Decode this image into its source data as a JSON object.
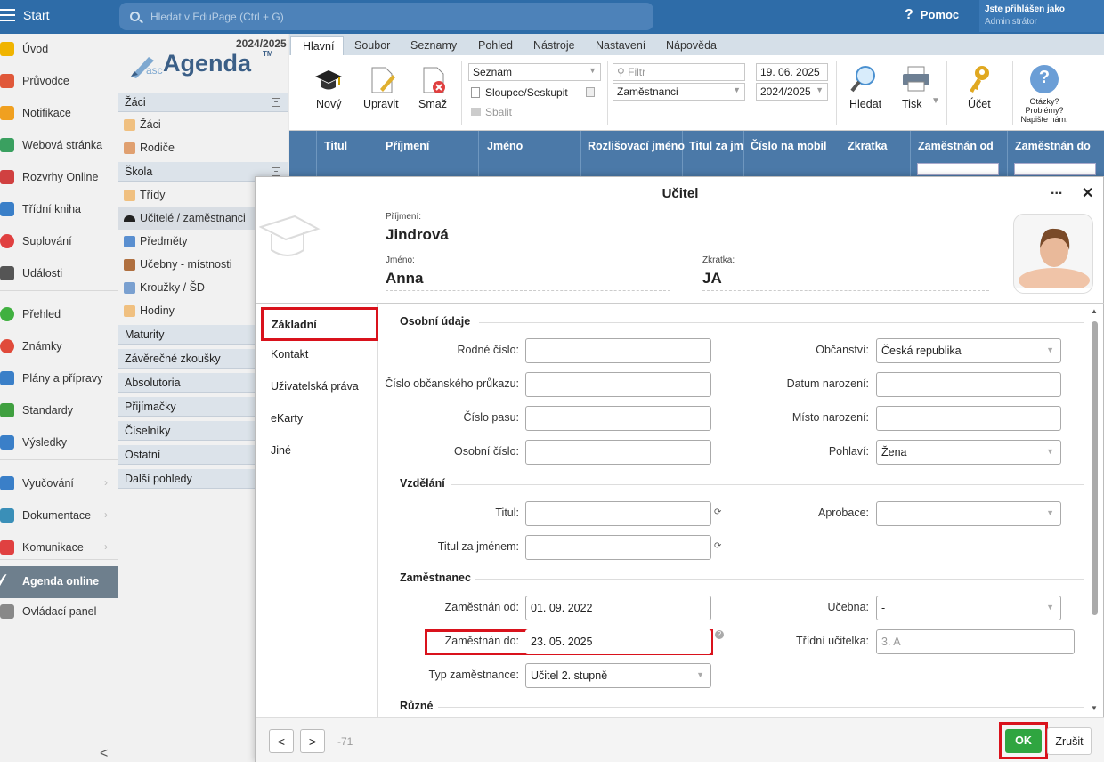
{
  "topbar": {
    "start": "Start",
    "search_placeholder": "Hledat v EduPage (Ctrl + G)",
    "help": "Pomoc",
    "user_line1": "Jste přihlášen jako",
    "user_line2": "Administrátor"
  },
  "nav": [
    {
      "label": "Úvod",
      "icon": "star-icon",
      "color": "#f0b400"
    },
    {
      "label": "Průvodce",
      "icon": "wand-icon",
      "color": "#e0583a"
    },
    {
      "label": "Notifikace",
      "icon": "mail-icon",
      "color": "#f0a020"
    },
    {
      "label": "Webová stránka",
      "icon": "home-icon",
      "color": "#3aa060"
    },
    {
      "label": "Rozvrhy Online",
      "icon": "calendar-icon",
      "color": "#d04040"
    },
    {
      "label": "Třídní kniha",
      "icon": "book-icon",
      "color": "#3a7fc8"
    },
    {
      "label": "Suplování",
      "icon": "person-icon",
      "color": "#e04040"
    },
    {
      "label": "Události",
      "icon": "calendar-icon",
      "color": "#555"
    },
    {
      "label": "Přehled",
      "icon": "check-icon",
      "color": "#40b040"
    },
    {
      "label": "Známky",
      "icon": "grades-icon",
      "color": "#e04a3a"
    },
    {
      "label": "Plány a přípravy",
      "icon": "briefcase-icon",
      "color": "#3a7fc8"
    },
    {
      "label": "Standardy",
      "icon": "shield-icon",
      "color": "#40a040"
    },
    {
      "label": "Výsledky",
      "icon": "bar-chart-icon",
      "color": "#3a7fc8"
    },
    {
      "label": "Vyučování",
      "icon": "open-book-icon",
      "color": "#3a7fc8"
    },
    {
      "label": "Dokumentace",
      "icon": "document-icon",
      "color": "#3a8fb8"
    },
    {
      "label": "Komunikace",
      "icon": "chat-icon",
      "color": "#e04040"
    },
    {
      "label": "Agenda online",
      "icon": "agenda-icon",
      "color": "#ffffff"
    },
    {
      "label": "Ovládací panel",
      "icon": "gear-icon",
      "color": "#888"
    }
  ],
  "agenda": {
    "year": "2024/2025",
    "logo_asc": "asc",
    "logo_agenda": "Agenda",
    "logo_tm": "TM",
    "sec_zaci": "Žáci",
    "item_zaci": "Žáci",
    "item_rodice": "Rodiče",
    "sec_skola": "Škola",
    "item_tridy": "Třídy",
    "item_ucitele": "Učitelé / zaměstnanci",
    "item_predmety": "Předměty",
    "item_ucebny": "Učebny - místnosti",
    "item_krouzky": "Kroužky / ŠD",
    "item_hodiny": "Hodiny",
    "maturity": "Maturity",
    "zaverecne": "Závěrečné zkoušky",
    "absolutoria": "Absolutoria",
    "prijimacky": "Přijímačky",
    "ciselniky": "Číselníky",
    "ostatni": "Ostatní",
    "dalsi": "Další pohledy"
  },
  "ribbon": {
    "tabs": [
      "Hlavní",
      "Soubor",
      "Seznamy",
      "Pohled",
      "Nástroje",
      "Nastavení",
      "Nápověda"
    ],
    "btn_novy": "Nový",
    "btn_upravit": "Upravit",
    "btn_smaz": "Smaž",
    "view_select": "Seznam",
    "sloupce": "Sloupce/Seskupit",
    "sbalit": "Sbalit",
    "filter_placeholder": "Filtr",
    "filter_select": "Zaměstnanci",
    "date": "19. 06. 2025",
    "year_select": "2024/2025",
    "btn_hledat": "Hledat",
    "btn_tisk": "Tisk",
    "btn_ucet": "Účet",
    "help1": "Otázky?",
    "help2": "Problémy?",
    "help3": "Napište nám."
  },
  "grid_headers": [
    "Titul",
    "Příjmení",
    "Jméno",
    "Rozlišovací jméno",
    "Titul za jm",
    "Číslo na mobil",
    "Zkratka",
    "Zaměstnán od",
    "Zaměstnán do"
  ],
  "dialog": {
    "title": "Učitel",
    "more": "...",
    "close": "✕",
    "lbl_prijmeni": "Příjmení:",
    "val_prijmeni": "Jindrová",
    "lbl_jmeno": "Jméno:",
    "val_jmeno": "Anna",
    "lbl_zkratka": "Zkratka:",
    "val_zkratka": "JA",
    "side_tabs": [
      "Základní",
      "Kontakt",
      "Uživatelská práva",
      "eKarty",
      "Jiné"
    ],
    "sec_osobni": "Osobní údaje",
    "sec_vzdelani": "Vzdělání",
    "sec_zamestnanec": "Zaměstnanec",
    "sec_ruzne": "Různé",
    "f_rodne_cislo": "Rodné číslo:",
    "f_op": "Číslo občanského průkazu:",
    "f_pas": "Číslo pasu:",
    "f_osobni": "Osobní číslo:",
    "f_obcanstvi": "Občanství:",
    "v_obcanstvi": "Česká republika",
    "f_datum": "Datum narození:",
    "f_misto": "Místo narození:",
    "f_pohlavi": "Pohlaví:",
    "v_pohlavi": "Žena",
    "f_titul": "Titul:",
    "f_titul_za": "Titul za jménem:",
    "f_aprobace": "Aprobace:",
    "f_od": "Zaměstnán od:",
    "v_od": "01. 09. 2022",
    "f_do": "Zaměstnán do:",
    "v_do": "23. 05. 2025",
    "f_typ": "Typ zaměstnance:",
    "v_typ": "Učitel 2. stupně",
    "f_ucebna": "Učebna:",
    "v_ucebna": "-",
    "f_tridni": "Třídní učitelka:",
    "v_tridni": "3. A",
    "prev": "<",
    "next": ">",
    "record": "-71",
    "ok": "OK",
    "cancel": "Zrušit"
  }
}
